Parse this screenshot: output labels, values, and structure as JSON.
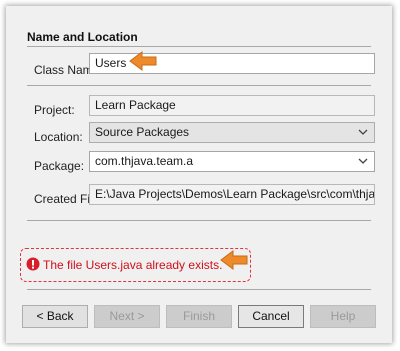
{
  "section": {
    "title": "Name and Location"
  },
  "form": {
    "class_name": {
      "label": "Class Name:",
      "value": "Users"
    },
    "project": {
      "label": "Project:",
      "value": "Learn Package"
    },
    "location": {
      "label": "Location:",
      "value": "Source Packages"
    },
    "package": {
      "label": "Package:",
      "value": "com.thjava.team.a"
    },
    "created_file": {
      "label": "Created File:",
      "value": "E:\\Java Projects\\Demos\\Learn Package\\src\\com\\thjava\\team\\a\\Users.java"
    }
  },
  "error": {
    "message": "The file Users.java already exists."
  },
  "buttons": {
    "back": "< Back",
    "next": "Next >",
    "finish": "Finish",
    "cancel": "Cancel",
    "help": "Help"
  },
  "colors": {
    "error": "#d0101a",
    "highlight_arrow": "#ef8a2a",
    "dashed_border": "#e0333d"
  },
  "icons": [
    "chevron-down-icon",
    "error-icon",
    "pointer-arrow-icon"
  ]
}
